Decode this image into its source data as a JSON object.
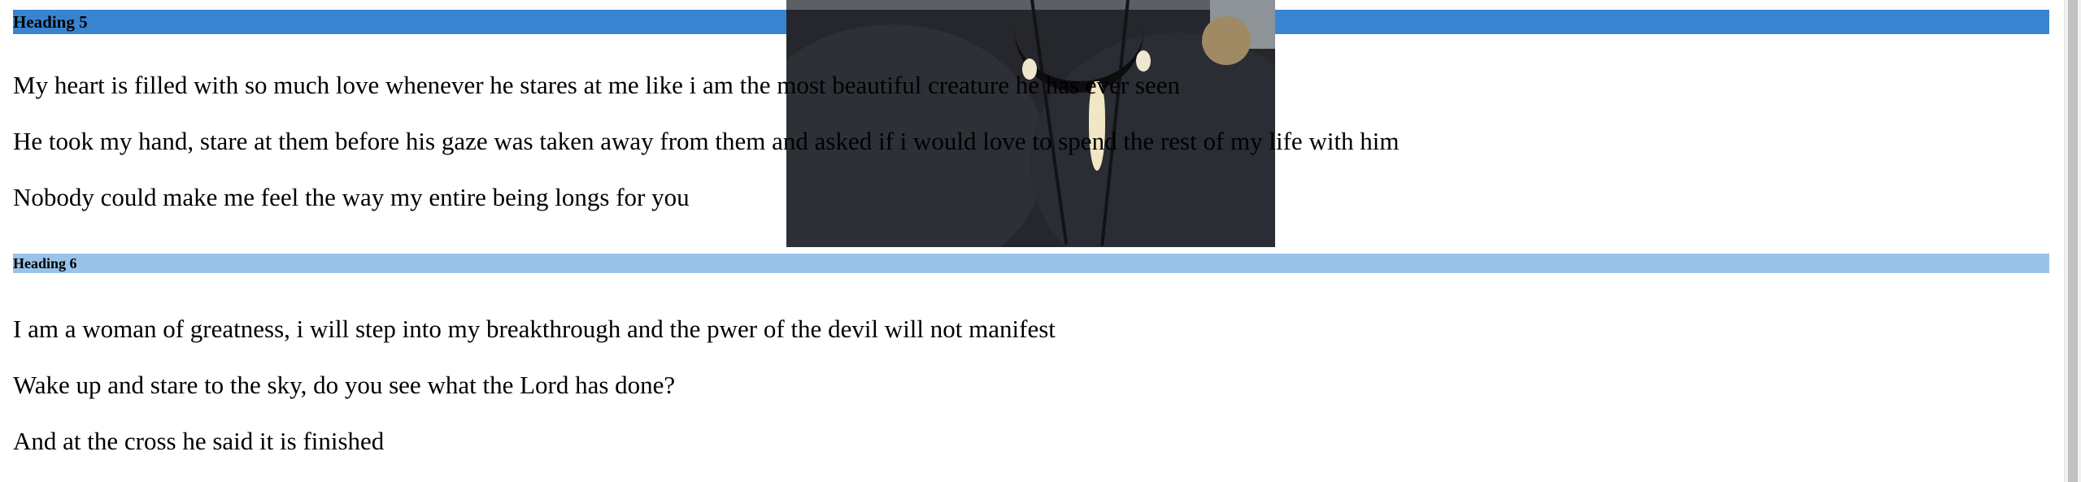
{
  "sections": [
    {
      "heading": "Heading 5",
      "heading_bg": "#3984d1",
      "paragraphs": [
        "My heart is filled with so much love whenever he stares at me like i am the most beautiful creature he has ever seen",
        "He took my hand, stare at them before his gaze was taken away from them and asked if i would love to spend the rest of my life with him",
        "Nobody could make me feel the way my entire being longs for you"
      ]
    },
    {
      "heading": "Heading 6",
      "heading_bg": "#99c3e9",
      "paragraphs": [
        "I am a woman of greatness, i will step into my breakthrough and the pwer of the devil will not manifest",
        "Wake up and stare to the sky, do you see what the Lord has done?",
        "And at the cross he said it is finished"
      ]
    }
  ],
  "image": {
    "description_icon": "portrait-photo"
  }
}
